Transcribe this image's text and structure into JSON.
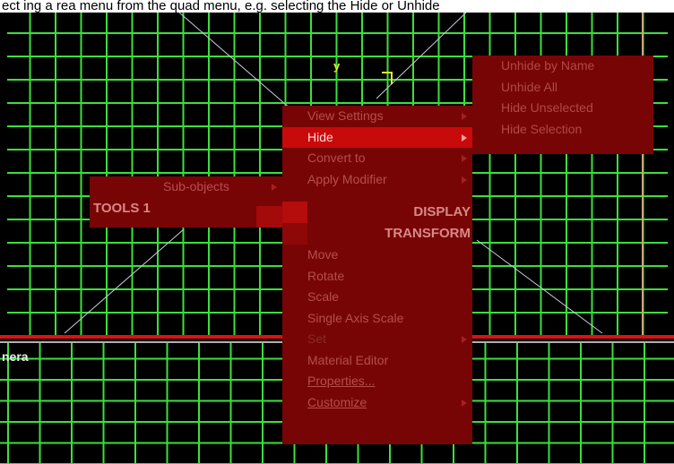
{
  "caption": "ect ing a rea menu from the quad menu, e.g. selecting the Hide or Unhide",
  "viewport": {
    "axis_label": "y",
    "view_name": "nera"
  },
  "quad_menu": {
    "top_items": [
      {
        "label": "View Settings",
        "submenu": true,
        "active": false
      },
      {
        "label": "Hide",
        "submenu": true,
        "active": true
      },
      {
        "label": "Convert to",
        "submenu": true,
        "active": false
      },
      {
        "label": "Apply Modifier",
        "submenu": true,
        "active": false
      }
    ],
    "display_title": "DISPLAY",
    "transform_title": "TRANSFORM",
    "bottom_items": [
      {
        "label": "Move",
        "dim": false
      },
      {
        "label": "Rotate",
        "dim": false
      },
      {
        "label": "Scale",
        "dim": false
      },
      {
        "label": "Single Axis Scale",
        "dim": false
      },
      {
        "label": "Set",
        "dim": true,
        "submenu": true
      },
      {
        "label": "Material Editor",
        "dim": false
      },
      {
        "label": "Properties...",
        "dim": false
      },
      {
        "label": "Customize",
        "dim": false,
        "submenu": true
      }
    ]
  },
  "tools_quad": {
    "item": "Sub-objects",
    "title": "TOOLS 1"
  },
  "hide_submenu": {
    "items": [
      "Unhide by Name",
      "Unhide All",
      "Hide Unselected",
      "Hide Selection"
    ]
  },
  "colors": {
    "grid": "#3be03b",
    "menu_bg": "#780505",
    "menu_active": "#c80a0a",
    "menu_text": "#b54e4e",
    "axis": "#e6e62a"
  }
}
